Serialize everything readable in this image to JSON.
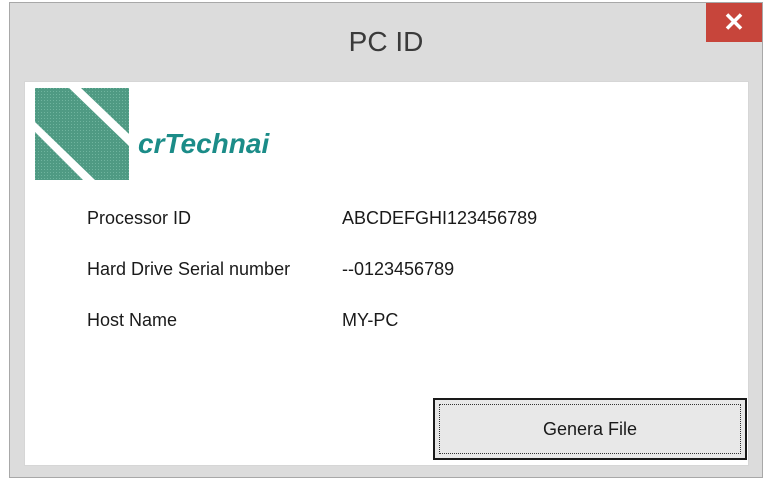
{
  "window": {
    "title": "PC ID",
    "close_glyph": "✕"
  },
  "logo": {
    "text": "crTechnai",
    "icon": "crtechnai-logo-mark",
    "color": "#1b8c88",
    "mark_color": "#4f9a83"
  },
  "info": {
    "rows": [
      {
        "label": "Processor ID",
        "value": "ABCDEFGHI123456789"
      },
      {
        "label": "Hard Drive Serial number",
        "value": "--0123456789"
      },
      {
        "label": "Host Name",
        "value": "MY-PC"
      }
    ]
  },
  "actions": {
    "genera_label": "Genera File"
  },
  "colors": {
    "close_button": "#c7453b",
    "window_frame": "#dcdcdc"
  }
}
